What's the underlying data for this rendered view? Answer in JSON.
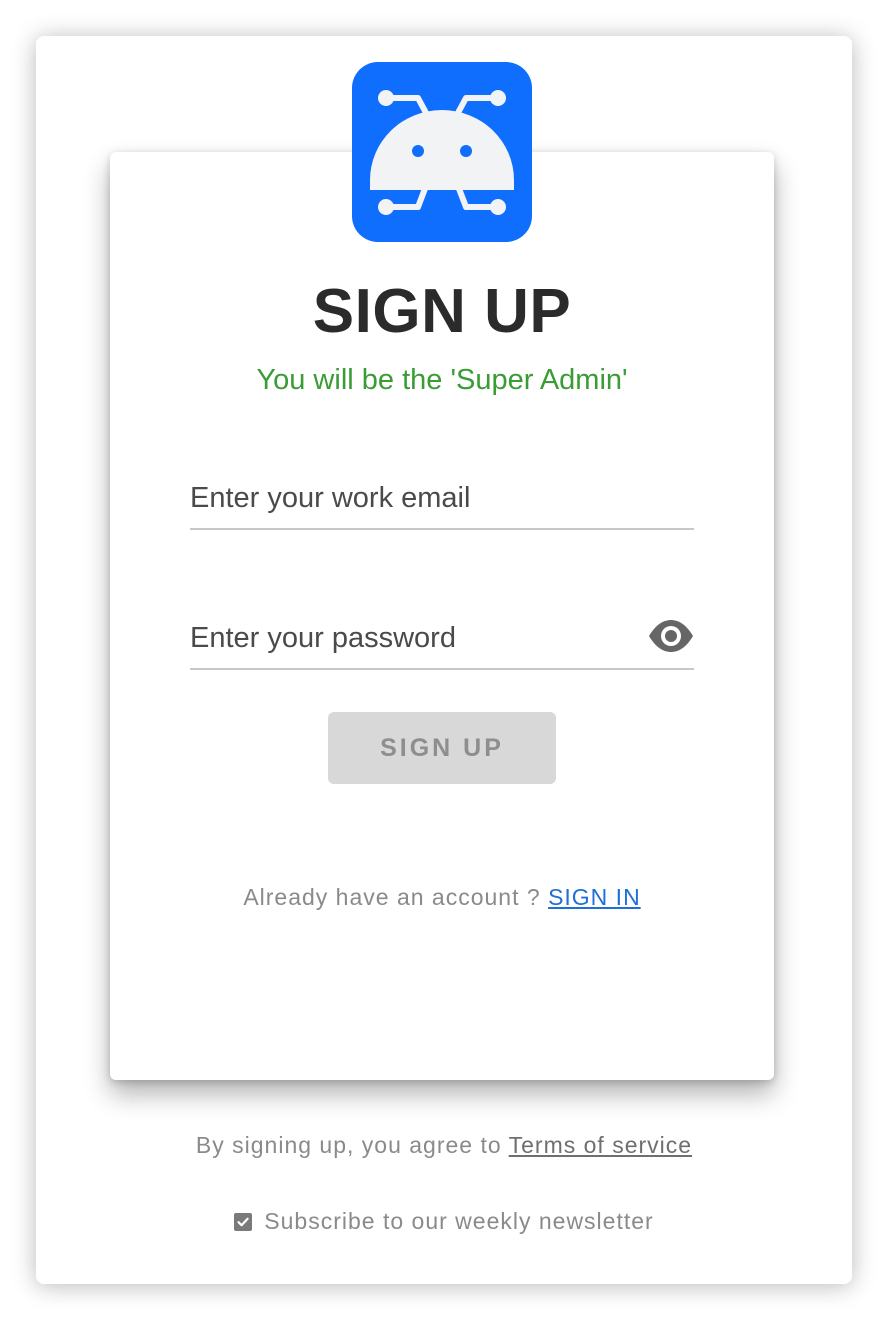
{
  "header": {
    "title": "SIGN UP",
    "subtitle": "You will be the 'Super Admin'"
  },
  "form": {
    "email_placeholder": "Enter your work email",
    "email_value": "",
    "password_placeholder": "Enter your password",
    "password_value": "",
    "submit_label": "SIGN UP"
  },
  "signin_prompt": {
    "text": "Already have an account ? ",
    "link_label": "SIGN IN"
  },
  "footer": {
    "terms_text": "By signing up, you agree to ",
    "terms_link": "Terms of service",
    "newsletter_label": "Subscribe to our weekly newsletter",
    "newsletter_checked": true
  },
  "colors": {
    "brand": "#0f6efd",
    "subtitle": "#3a9c35",
    "link": "#1f6fd8",
    "button_disabled_bg": "#d8d8d8"
  },
  "icons": {
    "logo": "bug-robot-logo",
    "password_toggle": "eye-icon",
    "newsletter_check": "check-icon"
  }
}
